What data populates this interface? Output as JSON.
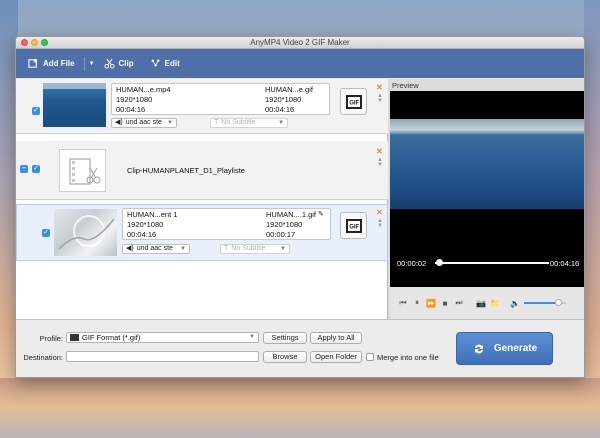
{
  "window": {
    "title": "AnyMP4 Video 2 GIF Maker"
  },
  "toolbar": {
    "add_file_label": "Add File",
    "clip_label": "Clip",
    "edit_label": "Edit"
  },
  "files": [
    {
      "source_name": "HUMAN...e.mp4",
      "source_resolution": "1920*1080",
      "source_duration": "00:04:16",
      "output_name": "HUMAN...e.gif",
      "output_resolution": "1920*1080",
      "output_duration": "00:04:16",
      "audio": "und aac ste",
      "subtitle": "No Subtitle"
    },
    {
      "playlist_name": "Clip-HUMANPLANET_D1_Playliste"
    },
    {
      "source_name": "HUMAN...ent 1",
      "source_resolution": "1920*1080",
      "source_duration": "00:04:16",
      "output_name": "HUMAN....1.gif",
      "output_resolution": "1920*1080",
      "output_duration": "00:00:17",
      "audio": "und aac ste",
      "subtitle": "No Subtitle"
    }
  ],
  "preview": {
    "label": "Preview",
    "current_time": "00:00:02",
    "total_time": "00:04:16",
    "progress": 0.01,
    "volume": 0.8
  },
  "bottom": {
    "profile_label": "Profile:",
    "profile_value": "GIF Format (*.gif)",
    "settings_label": "Settings",
    "apply_all_label": "Apply to All",
    "destination_label": "Destination:",
    "destination_value": "",
    "browse_label": "Browse",
    "open_folder_label": "Open Folder",
    "merge_label": "Merge into one file",
    "generate_label": "Generate"
  },
  "colors": {
    "toolbar_bg": "#4f6fa8",
    "accent": "#3b8ee8",
    "generate_bg": "#4f7fc7",
    "remove_icon": "#e58a2b"
  }
}
